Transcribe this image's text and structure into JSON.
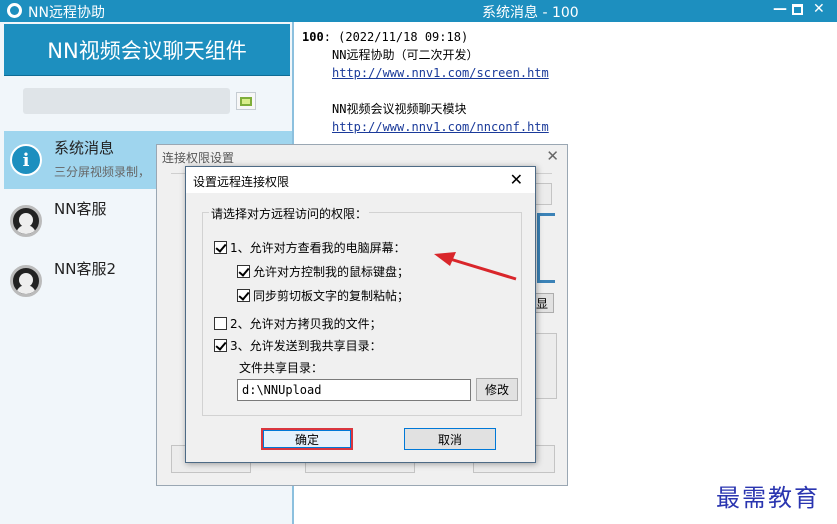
{
  "app": {
    "title": "NN远程协助"
  },
  "window": {
    "title": "系统消息 - 100"
  },
  "sidebar": {
    "banner": "NN视频会议聊天组件",
    "contacts": [
      {
        "name": "系统消息",
        "preview": "三分屏视频录制，",
        "selected": true,
        "icon": "info-icon"
      },
      {
        "name": "NN客服",
        "icon": "user-avatar"
      },
      {
        "name": "NN客服2",
        "icon": "user-avatar"
      }
    ]
  },
  "messages": {
    "sender": "100",
    "timestamp": ": (2022/11/18 09:18)",
    "line1": "NN远程协助（可二次开发）",
    "link1": "http://www.nnv1.com/screen.htm",
    "line2": "NN视频会议视频聊天模块",
    "link2": "http://www.nnv1.com/nnconf.htm"
  },
  "outer_dialog": {
    "title": "连接权限设置",
    "partial_button": "显"
  },
  "modal": {
    "title": "设置远程连接权限",
    "group_label": "请选择对方远程访问的权限：",
    "options": [
      {
        "label": "1、允许对方查看我的电脑屏幕：",
        "checked": true
      },
      {
        "label": "允许对方控制我的鼠标键盘；",
        "checked": true
      },
      {
        "label": "同步剪切板文字的复制粘帖；",
        "checked": true
      },
      {
        "label": "2、允许对方拷贝我的文件；",
        "checked": false
      },
      {
        "label": "3、允许发送到我共享目录：",
        "checked": true
      }
    ],
    "share_dir_label": "文件共享目录：",
    "share_dir_value": "d:\\NNUpload",
    "edit_label": "修改",
    "ok_label": "确定",
    "cancel_label": "取消"
  },
  "watermark": "最需教育",
  "colors": {
    "titlebar": "#1d8fbf",
    "selected": "#9fd5ee",
    "arrow": "#d9262b",
    "watermark": "#2a35b0"
  }
}
